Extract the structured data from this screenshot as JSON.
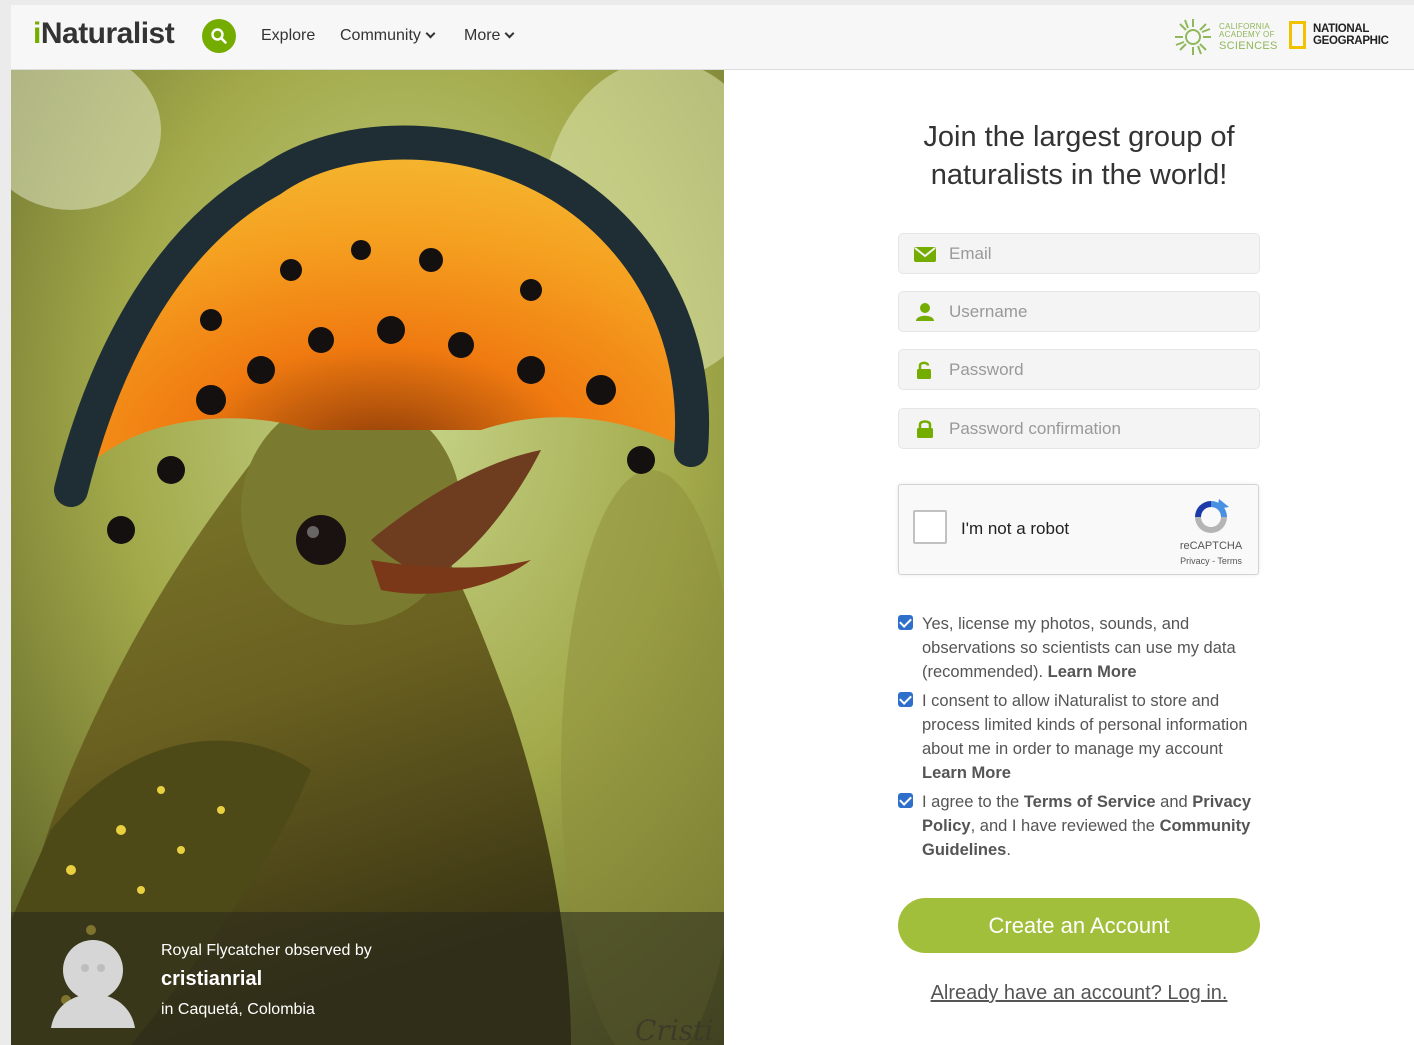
{
  "header": {
    "logo_i": "i",
    "logo_rest": "Naturalist",
    "nav": [
      {
        "label": "Explore",
        "dropdown": false
      },
      {
        "label": "Community",
        "dropdown": true
      },
      {
        "label": "More",
        "dropdown": true
      }
    ],
    "partners": {
      "cas": [
        "CALIFORNIA",
        "ACADEMY OF",
        "SCIENCES"
      ],
      "natgeo": [
        "NATIONAL",
        "GEOGRAPHIC"
      ]
    }
  },
  "photo": {
    "caption_line": "Royal Flycatcher observed by",
    "username": "cristianrial",
    "location": "in Caquetá, Colombia",
    "watermark": "Cristi"
  },
  "signup": {
    "heading": "Join the largest group of naturalists in the world!",
    "fields": {
      "email": "Email",
      "username": "Username",
      "password": "Password",
      "password_confirmation": "Password confirmation"
    },
    "captcha": {
      "label": "I'm not a robot",
      "brand": "reCAPTCHA",
      "links": "Privacy - Terms"
    },
    "checks": {
      "license": {
        "text": "Yes, license my photos, sounds, and observations so scientists can use my data (recommended). ",
        "link": "Learn More"
      },
      "consent": {
        "text": "I consent to allow iNaturalist to store and process limited kinds of personal information about me in order to manage my account ",
        "link": "Learn More"
      },
      "terms": {
        "t1": "I agree to the ",
        "tos": "Terms of Service",
        "t2": " and ",
        "privacy": "Privacy Policy",
        "t3": ", and I have reviewed the ",
        "guidelines": "Community Guidelines",
        "t4": "."
      }
    },
    "create_button": "Create an Account",
    "login_link": "Already have an account? Log in."
  },
  "colors": {
    "brand_green": "#74ac00",
    "button_green": "#a2bf3c",
    "checkbox_blue": "#2f6fcc"
  }
}
